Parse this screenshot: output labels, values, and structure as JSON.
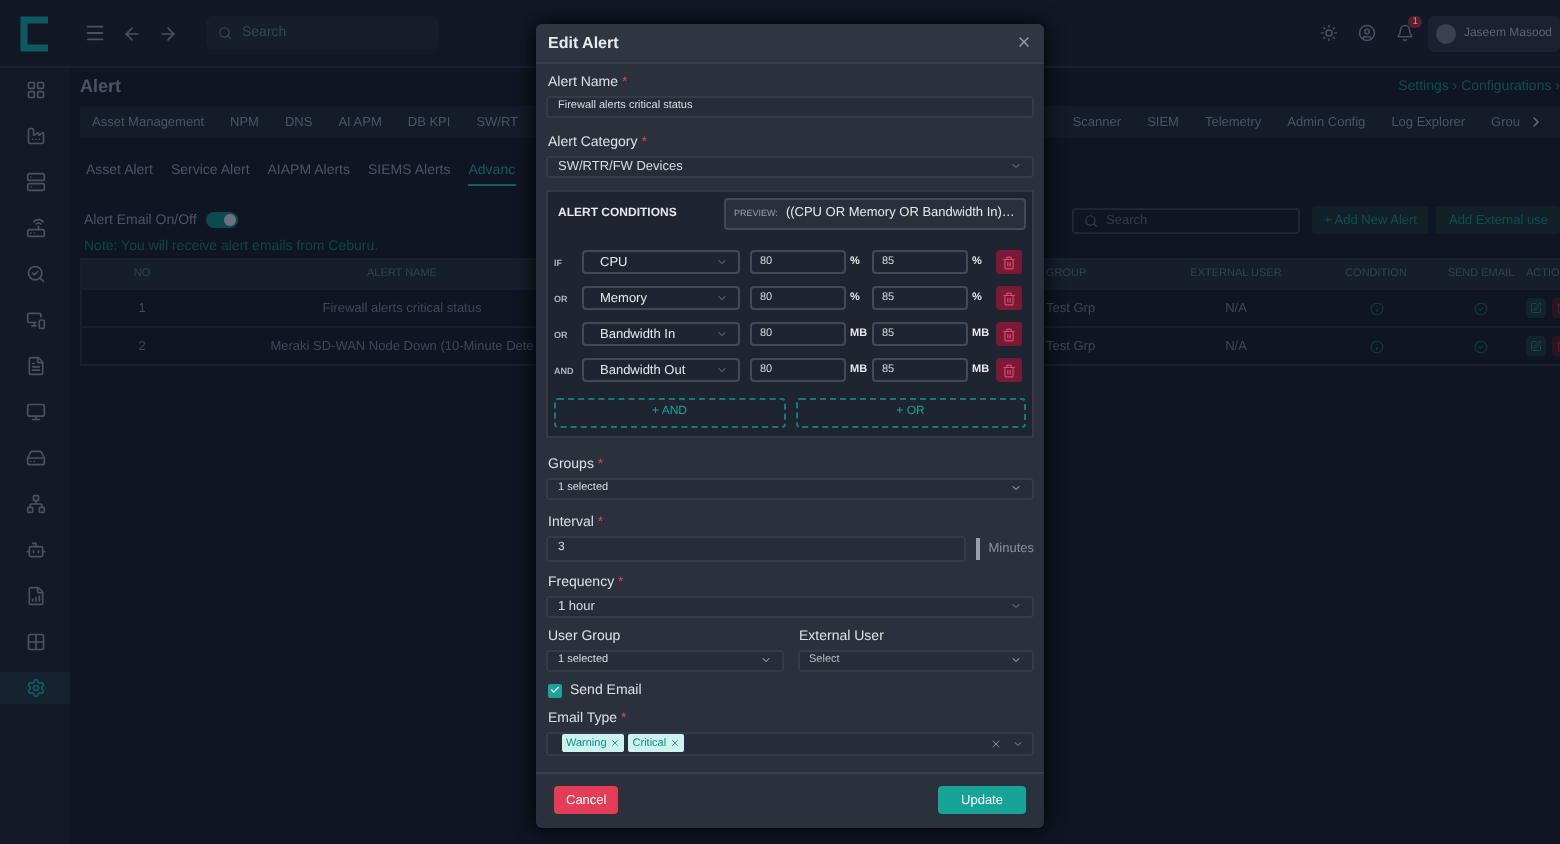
{
  "topbar": {
    "search_placeholder": "Search",
    "user_name": "Jaseem Masood",
    "notification_badge": "1"
  },
  "sidebar": {
    "items": [
      {
        "selected": false
      },
      {
        "selected": false
      },
      {
        "selected": false
      },
      {
        "selected": false
      },
      {
        "selected": false
      },
      {
        "selected": false
      },
      {
        "selected": false
      },
      {
        "selected": false
      },
      {
        "selected": false
      },
      {
        "selected": false
      },
      {
        "selected": false
      },
      {
        "selected": false
      },
      {
        "selected": false
      },
      {
        "selected": true
      }
    ]
  },
  "page": {
    "title": "Alert",
    "breadcrumb": "Settings › Configurations ›"
  },
  "top_tabs": [
    {
      "label": "Asset Management",
      "selected": false
    },
    {
      "label": "NPM",
      "selected": false
    },
    {
      "label": "DNS",
      "selected": false
    },
    {
      "label": "AI APM",
      "selected": false
    },
    {
      "label": "DB KPI",
      "selected": false
    },
    {
      "label": "SW/RT",
      "selected": false
    },
    {
      "label": "Scanner",
      "selected": false
    },
    {
      "label": "SIEM",
      "selected": false
    },
    {
      "label": "Telemetry",
      "selected": false
    },
    {
      "label": "Admin Config",
      "selected": false
    },
    {
      "label": "Log Explorer",
      "selected": false
    },
    {
      "label": "Grou",
      "selected": false
    }
  ],
  "sub_tabs": [
    {
      "label": "Asset Alert",
      "selected": false
    },
    {
      "label": "Service Alert",
      "selected": false
    },
    {
      "label": "AIAPM Alerts",
      "selected": false
    },
    {
      "label": "SIEMS Alerts",
      "selected": false
    },
    {
      "label": "Advanc",
      "selected": true
    }
  ],
  "email_toggle": {
    "label": "Alert Email On/Off",
    "on": true
  },
  "note": "Note: You will receive alert emails from Ceburu.",
  "toolbar": {
    "search_placeholder": "Search",
    "add_button": "+ Add New Alert",
    "external_button": "Add External use"
  },
  "table": {
    "columns": [
      "NO",
      "ALERT NAME",
      "GROUP",
      "EXTERNAL USER",
      "CONDITION",
      "SEND EMAIL",
      "ACTIO"
    ],
    "rows": [
      {
        "no": "1",
        "name": "Firewall alerts critical status",
        "group": "Test Grp",
        "external_user": "N/A"
      },
      {
        "no": "2",
        "name": "Meraki SD-WAN Node Down (10-Minute Dete",
        "group": "Test Grp",
        "external_user": "N/A"
      }
    ]
  },
  "dialog": {
    "title": "Edit Alert",
    "alert_name": {
      "label": "Alert Name",
      "required_mark": "*",
      "value": "Firewall alerts critical status"
    },
    "alert_category": {
      "label": "Alert Category",
      "required_mark": "*",
      "value": "SW/RTR/FW Devices"
    },
    "conditions": {
      "title": "ALERT CONDITIONS",
      "preview_label": "PREVIEW:",
      "preview": "((CPU OR Memory OR Bandwidth In)…",
      "rows": [
        {
          "operator": "IF",
          "metric": "CPU",
          "min": "80",
          "unit_1": "%",
          "max": "85",
          "unit_2": "%"
        },
        {
          "operator": "OR",
          "metric": "Memory",
          "min": "80",
          "unit_1": "%",
          "max": "85",
          "unit_2": "%"
        },
        {
          "operator": "OR",
          "metric": "Bandwidth In",
          "min": "80",
          "unit_1": "MB",
          "max": "85",
          "unit_2": "MB"
        },
        {
          "operator": "AND",
          "metric": "Bandwidth Out",
          "min": "80",
          "unit_1": "MB",
          "max": "85",
          "unit_2": "MB"
        }
      ],
      "and_button": "+ AND",
      "or_button": "+ OR"
    },
    "groups": {
      "label": "Groups",
      "required_mark": "*",
      "value": "1 selected"
    },
    "interval": {
      "label": "Interval",
      "required_mark": "*",
      "value": "3",
      "unit": "Minutes"
    },
    "frequency": {
      "label": "Frequency",
      "required_mark": "*",
      "value": "1 hour"
    },
    "user_group": {
      "label": "User Group",
      "value": "1 selected"
    },
    "external_user": {
      "label": "External User",
      "placeholder": "Select"
    },
    "send_email": {
      "label": "Send Email",
      "checked": true
    },
    "email_type": {
      "label": "Email Type",
      "required_mark": "*",
      "tags": [
        {
          "label": "Warning"
        },
        {
          "label": "Critical"
        }
      ]
    },
    "cancel_button": "Cancel",
    "update_button": "Update"
  }
}
